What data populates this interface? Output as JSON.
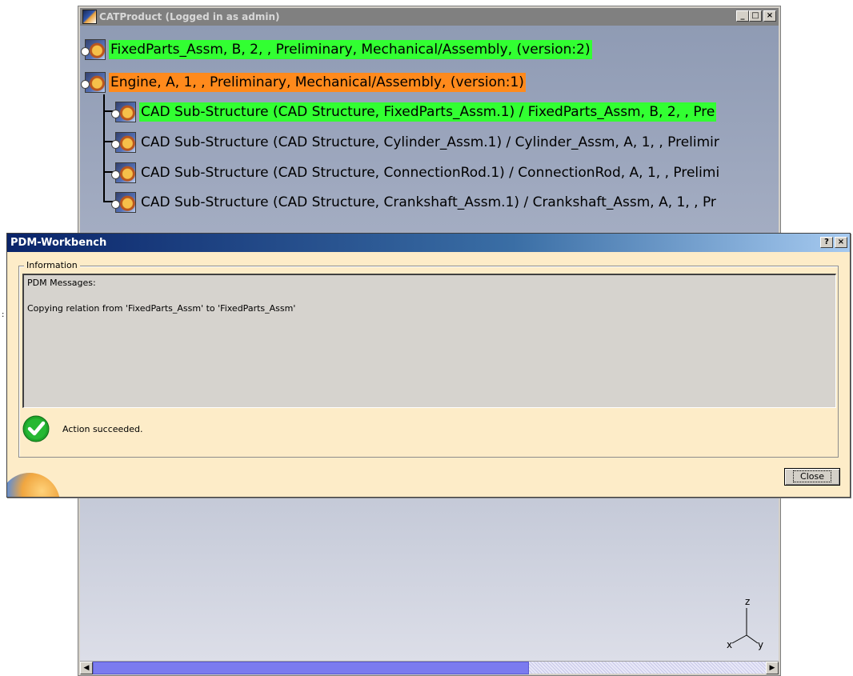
{
  "cat_window": {
    "title": "CATProduct (Logged in as admin)",
    "caption_buttons": {
      "minimize": "_",
      "maximize": "□",
      "close": "×"
    },
    "tree": [
      {
        "label": "FixedParts_Assm, B, 2, , Preliminary, Mechanical/Assembly,  (version:2)",
        "highlight": "#32ff32"
      },
      {
        "label": "Engine, A, 1, , Preliminary, Mechanical/Assembly,  (version:1)",
        "highlight": "#ff8a1c"
      },
      {
        "label": "CAD Sub-Structure (CAD Structure, FixedParts_Assm.1) / FixedParts_Assm, B, 2, , Pre",
        "highlight": "#32ff32"
      },
      {
        "label": "CAD Sub-Structure (CAD Structure, Cylinder_Assm.1) / Cylinder_Assm, A, 1, , Prelimir",
        "highlight": ""
      },
      {
        "label": "CAD Sub-Structure (CAD Structure, ConnectionRod.1) / ConnectionRod, A, 1, , Prelimi",
        "highlight": ""
      },
      {
        "label": "CAD Sub-Structure (CAD Structure, Crankshaft_Assm.1) / Crankshaft_Assm, A, 1, , Pr",
        "highlight": ""
      }
    ],
    "compass": {
      "z": "z",
      "x": "x",
      "y": "y"
    },
    "scrollbar": {
      "left_arrow": "◀",
      "right_arrow": "▶"
    }
  },
  "pdm_dialog": {
    "title": "PDM-Workbench",
    "caption_buttons": {
      "help": "?",
      "close": "×"
    },
    "group_label": "Information",
    "messages": {
      "header": "PDM Messages:",
      "lines": [
        "Copying relation from 'FixedParts_Assm' to 'FixedParts_Assm'"
      ]
    },
    "status_text": "Action succeeded.",
    "close_label": "Close"
  },
  "colors": {
    "dialog_bg": "#fdecc8",
    "titlebar_start": "#0a246a",
    "titlebar_end": "#a6caf0",
    "success_green": "#1fa52a",
    "highlight_green": "#32ff32",
    "highlight_orange": "#ff8a1c"
  }
}
